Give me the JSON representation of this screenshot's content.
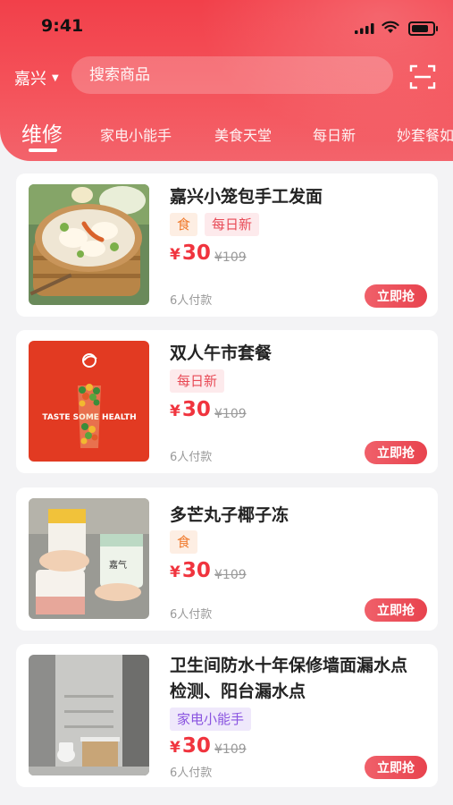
{
  "status_bar": {
    "time": "9:41"
  },
  "header": {
    "city": "嘉兴",
    "search_placeholder": "搜索商品",
    "tabs": [
      "维修",
      "家电小能手",
      "美食天堂",
      "每日新",
      "妙套餐如"
    ]
  },
  "products": [
    {
      "title": "嘉兴小笼包手工发面",
      "tags": [
        "食",
        "每日新"
      ],
      "currency": "¥",
      "price": "30",
      "original_price": "¥109",
      "paid": "6人付款",
      "button": "立即抢",
      "thumb": "dumpling-noodle-bowl"
    },
    {
      "title": "双人午市套餐",
      "tags": [
        "每日新"
      ],
      "currency": "¥",
      "price": "30",
      "original_price": "¥109",
      "paid": "6人付款",
      "button": "立即抢",
      "thumb": "taste-some-health-poster",
      "thumb_text": "TASTE SOME HEALTH"
    },
    {
      "title": "多芒丸子椰子冻",
      "tags": [
        "食"
      ],
      "currency": "¥",
      "price": "30",
      "original_price": "¥109",
      "paid": "6人付款",
      "button": "立即抢",
      "thumb": "jelly-cups"
    },
    {
      "title_line1": "卫生间防水十年保修墙面漏水点",
      "title_line2": "检测、阳台漏水点",
      "tags": [
        "家电小能手"
      ],
      "currency": "¥",
      "price": "30",
      "original_price": "¥109",
      "paid": "6人付款",
      "button": "立即抢",
      "thumb": "bathroom-photo"
    }
  ],
  "colors": {
    "accent": "#f2404a",
    "price": "#f0343e"
  }
}
